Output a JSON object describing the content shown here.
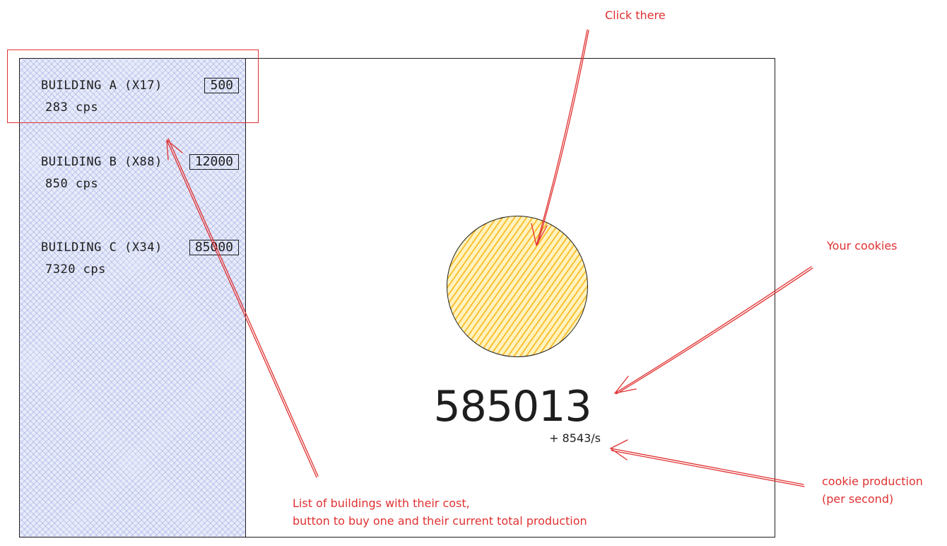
{
  "buildings": [
    {
      "name": "BUILDING A (x17)",
      "cost": "500",
      "cps": "283 cps"
    },
    {
      "name": "BUILDING B (x88)",
      "cost": "12000",
      "cps": "850 cps"
    },
    {
      "name": "BUILDING C (x34)",
      "cost": "85000",
      "cps": "7320 cps"
    }
  ],
  "game": {
    "cookie_count": "585013",
    "production_rate": "+ 8543/s"
  },
  "annotations": {
    "click_there": "Click there",
    "your_cookies": "Your cookies",
    "cookie_production_line1": "cookie production",
    "cookie_production_line2": "(per second)",
    "buildings_list_line1": "List of buildings with their cost,",
    "buildings_list_line2": "button to buy one and their current total production"
  },
  "colors": {
    "annotation": "#e03131",
    "sidebar_fill": "#5d6ec8",
    "cookie_fill": "#fab005",
    "stroke": "#1e1e1e"
  }
}
